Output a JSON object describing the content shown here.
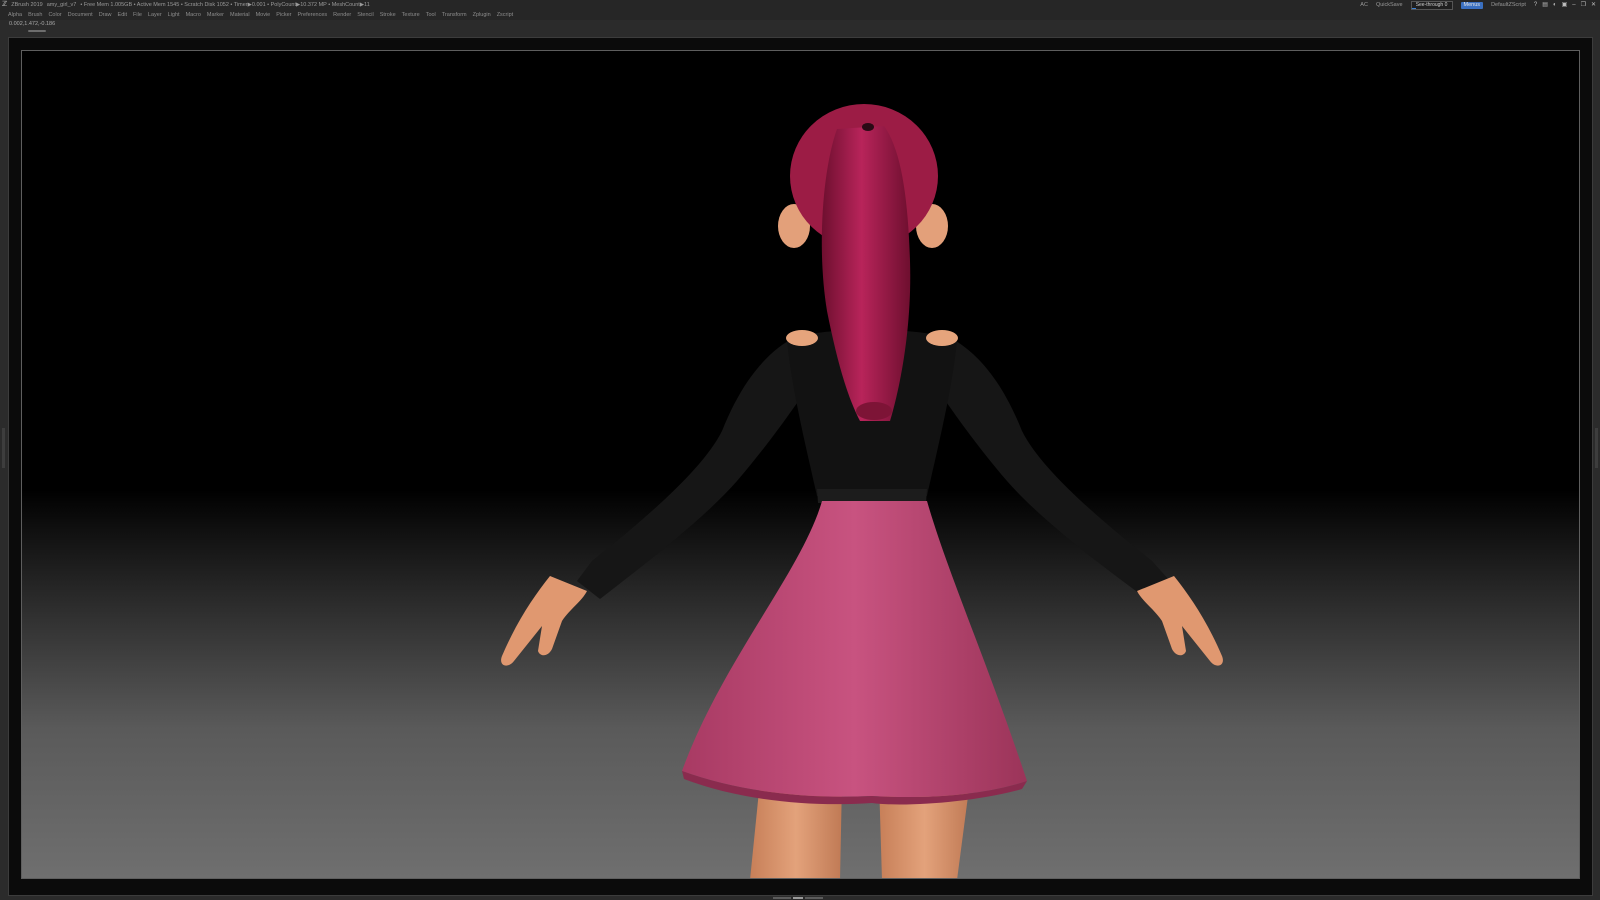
{
  "titlebar": {
    "app_name": "ZBrush 2019",
    "file_name": "amy_girl_v7",
    "stats": "• Free Mem 1.005GB • Active Mem 1545 • Scratch Disk 1052 • Timer▶0.001 • PolyCount▶10.372 MP • MeshCount▶11",
    "ac_label": "AC",
    "quicksave_label": "QuickSave",
    "see_through_label": "See-through",
    "see_through_value": "0",
    "menus_label": "Menus",
    "script_label": "DefaultZScript"
  },
  "menubar": {
    "items": [
      "Alpha",
      "Brush",
      "Color",
      "Document",
      "Draw",
      "Edit",
      "File",
      "Layer",
      "Light",
      "Macro",
      "Marker",
      "Material",
      "Movie",
      "Picker",
      "Preferences",
      "Render",
      "Stencil",
      "Stroke",
      "Texture",
      "Tool",
      "Transform",
      "Zplugin",
      "Zscript"
    ]
  },
  "coords": "0.002,1.472,-0.186",
  "colors": {
    "hair": "#a81d4a",
    "skin": "#e8a17a",
    "top": "#141414",
    "skirt": "#c04a75",
    "accent": "#3a6fc0"
  },
  "icons": [
    "zbrush-logo-icon",
    "help-icon",
    "layout-icon",
    "palette-icon",
    "lock-icon",
    "minimize-icon",
    "restore-icon",
    "close-icon"
  ]
}
